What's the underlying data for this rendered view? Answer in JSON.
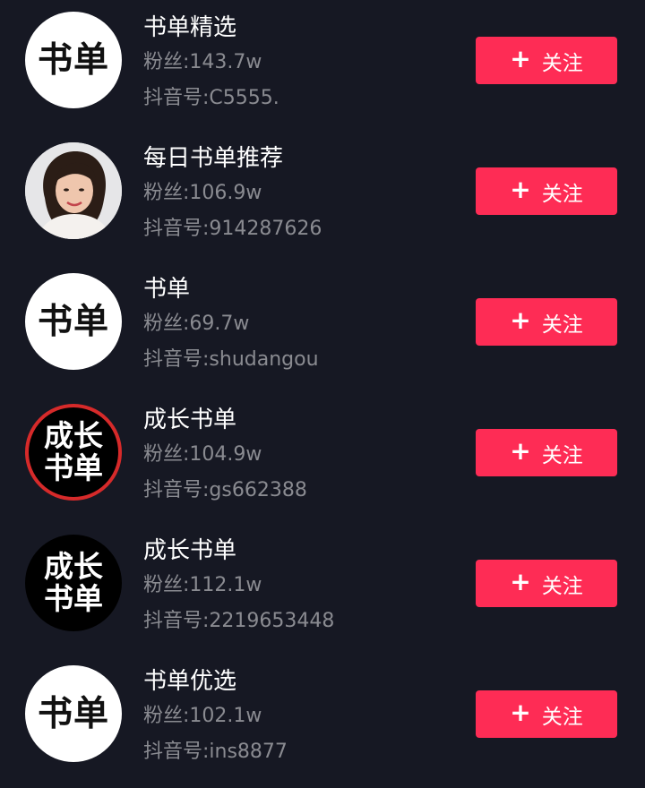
{
  "follow_label": "关注",
  "plus_symbol": "+",
  "accent_color": "#fe2c55",
  "accounts": [
    {
      "name": "书单精选",
      "fans": "粉丝:143.7w",
      "douyin_id": "抖音号:C5555.",
      "avatar": {
        "style": "white",
        "lines": [
          "书单"
        ]
      }
    },
    {
      "name": "每日书单推荐",
      "fans": "粉丝:106.9w",
      "douyin_id": "抖音号:914287626",
      "avatar": {
        "style": "photo",
        "lines": []
      }
    },
    {
      "name": "书单",
      "fans": "粉丝:69.7w",
      "douyin_id": "抖音号:shudangou",
      "avatar": {
        "style": "white",
        "lines": [
          "书单"
        ]
      }
    },
    {
      "name": "成长书单",
      "fans": "粉丝:104.9w",
      "douyin_id": "抖音号:gs662388",
      "avatar": {
        "style": "black-ring",
        "lines": [
          "成长",
          "书单"
        ]
      }
    },
    {
      "name": "成长书单",
      "fans": "粉丝:112.1w",
      "douyin_id": "抖音号:2219653448",
      "avatar": {
        "style": "black",
        "lines": [
          "成长",
          "书单"
        ]
      }
    },
    {
      "name": "书单优选",
      "fans": "粉丝:102.1w",
      "douyin_id": "抖音号:ins8877",
      "avatar": {
        "style": "white",
        "lines": [
          "书单"
        ]
      }
    }
  ]
}
